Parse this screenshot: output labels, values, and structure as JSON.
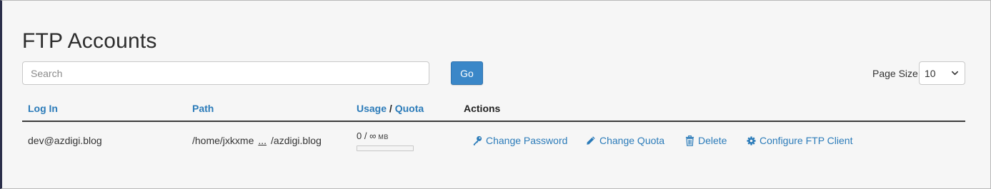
{
  "page": {
    "title": "FTP Accounts"
  },
  "search": {
    "placeholder": "Search",
    "value": ""
  },
  "go_button": {
    "label": "Go"
  },
  "page_size": {
    "label": "Page Size",
    "selected": "10"
  },
  "table": {
    "headers": {
      "login": "Log In",
      "path": "Path",
      "usage": "Usage",
      "separator": "/",
      "quota": "Quota",
      "actions": "Actions"
    },
    "rows": [
      {
        "login": "dev@azdigi.blog",
        "path_start": "/home/jxkxme",
        "path_ellipsis": "...",
        "path_end": "/azdigi.blog",
        "usage": "0 / ∞",
        "usage_unit": "MB",
        "usage_fraction": 0,
        "actions": {
          "change_password": "Change Password",
          "change_quota": "Change Quota",
          "delete": "Delete",
          "configure": "Configure FTP Client"
        }
      }
    ]
  },
  "icons": {
    "change_password": "key-icon",
    "change_quota": "pencil-icon",
    "delete": "trash-icon",
    "configure": "gear-icon"
  },
  "colors": {
    "link": "#2b7bb9",
    "primary_button": "#3a87c8",
    "header_rule": "#3d3d3d"
  }
}
